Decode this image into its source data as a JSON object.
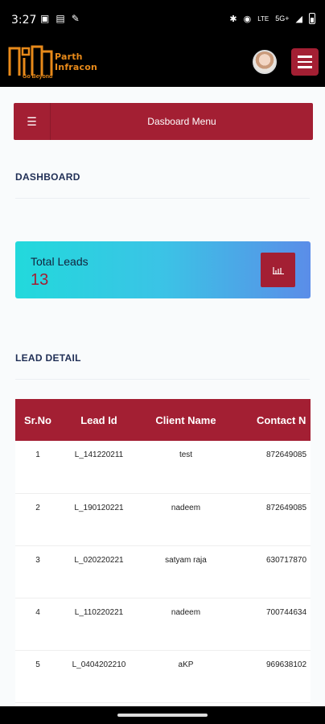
{
  "status": {
    "time": "3:27",
    "left_icons": [
      "sim-icon",
      "message-icon",
      "notification-icon"
    ],
    "right_icons": [
      "bluetooth-icon",
      "location-icon",
      "volte-icon",
      "network-5g-icon",
      "signal-icon",
      "battery-icon"
    ],
    "network_label": "5G+"
  },
  "brand": {
    "name": "Parth Infracon",
    "tagline": "Go Beyond"
  },
  "menu": {
    "label": "Dasboard Menu"
  },
  "dashboard": {
    "title": "DASHBOARD"
  },
  "leads_card": {
    "title": "Total Leads",
    "value": "13",
    "button_icon": "list-icon"
  },
  "lead_detail": {
    "title": "LEAD DETAIL",
    "columns": [
      "Sr.No",
      "Lead Id",
      "Client Name",
      "Contact N"
    ],
    "rows": [
      [
        "1",
        "L_141220211",
        "test",
        "872649085"
      ],
      [
        "2",
        "L_190120221",
        "nadeem",
        "872649085"
      ],
      [
        "3",
        "L_020220221",
        "satyam raja",
        "630717870"
      ],
      [
        "4",
        "L_110220221",
        "nadeem",
        "700744634"
      ],
      [
        "5",
        "L_0404202210",
        "aKP",
        "969638102"
      ]
    ]
  },
  "colors": {
    "primary": "#a31f33",
    "heading": "#1f2e55",
    "card_gradient_start": "#22d9dc",
    "card_gradient_end": "#5b8de8"
  }
}
